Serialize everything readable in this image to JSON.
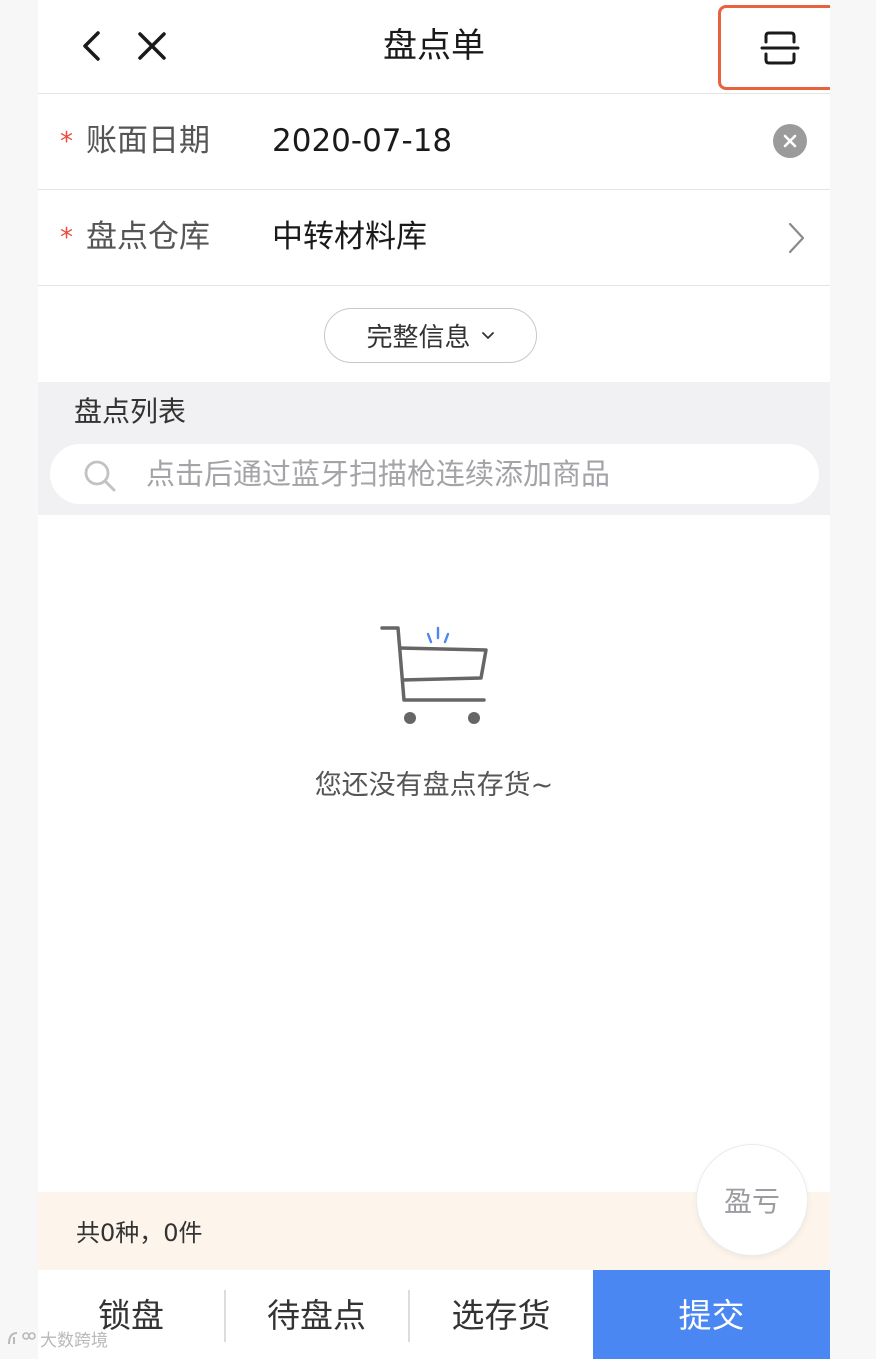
{
  "header": {
    "title": "盘点单",
    "back_icon": "chevron-left-icon",
    "close_icon": "close-icon",
    "scan_icon": "scan-icon",
    "scan_highlight_color": "#e8623d"
  },
  "form": {
    "date": {
      "required_mark": "*",
      "label": "账面日期",
      "value": "2020-07-18"
    },
    "warehouse": {
      "required_mark": "*",
      "label": "盘点仓库",
      "value": "中转材料库"
    }
  },
  "more_info": {
    "label": "完整信息"
  },
  "list": {
    "title": "盘点列表",
    "search_placeholder": "点击后通过蓝牙扫描枪连续添加商品"
  },
  "empty_state": {
    "icon": "shopping-cart-icon",
    "text": "您还没有盘点存货~"
  },
  "summary": {
    "text": "共0种，0件"
  },
  "float_button": {
    "label": "盈亏"
  },
  "bottom_bar": {
    "lock_label": "锁盘",
    "pending_label": "待盘点",
    "select_label": "选存货",
    "submit_label": "提交",
    "submit_color": "#4a87f2"
  },
  "watermark": {
    "text": "大数跨境"
  }
}
